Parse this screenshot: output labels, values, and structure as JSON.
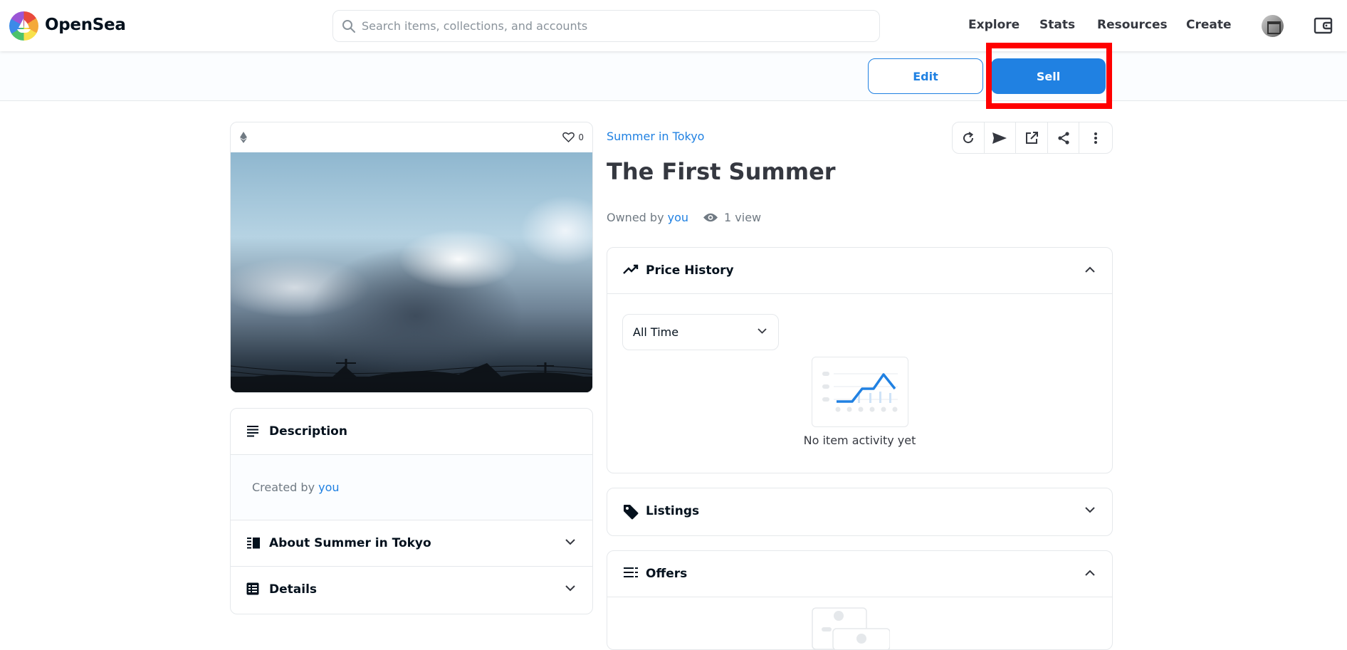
{
  "nav": {
    "brand": "OpenSea",
    "search_placeholder": "Search items, collections, and accounts",
    "links": [
      "Explore",
      "Stats",
      "Resources",
      "Create"
    ]
  },
  "actions": {
    "edit_label": "Edit",
    "sell_label": "Sell"
  },
  "media": {
    "favorites_count": "0"
  },
  "description": {
    "title": "Description",
    "created_by_prefix": "Created by",
    "creator": "you"
  },
  "about": {
    "title": "About Summer in Tokyo"
  },
  "details": {
    "title": "Details"
  },
  "item": {
    "collection": "Summer in Tokyo",
    "title": "The First Summer",
    "owned_by_prefix": "Owned by",
    "owner": "you",
    "views": "1 view"
  },
  "price_history": {
    "title": "Price History",
    "range": "All Time",
    "empty": "No item activity yet"
  },
  "listings": {
    "title": "Listings"
  },
  "offers": {
    "title": "Offers"
  },
  "colors": {
    "accent": "#2081e2",
    "highlight": "#ff0000"
  }
}
